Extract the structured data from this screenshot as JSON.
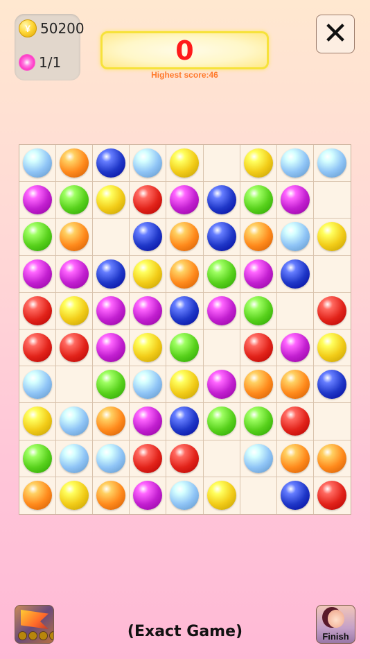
{
  "stats": {
    "coins": "50200",
    "lives": "1/1"
  },
  "score": {
    "current": "0",
    "highest_label": "Highest score:46"
  },
  "buttons": {
    "close_icon": "close-icon",
    "finish_label": "Finish"
  },
  "footer": {
    "mode_label": "(Exact Game)"
  },
  "colors": {
    "red": "#e2231a",
    "orange": "#ff8a1c",
    "yellow": "#f2cc18",
    "green": "#58d11c",
    "blue": "#1f37c8",
    "purple": "#c21fd0",
    "lightblue": "#8fc4f6"
  },
  "board": {
    "rows": 10,
    "cols": 9,
    "cells": [
      [
        "lightblue",
        "orange",
        "blue",
        "lightblue",
        "yellow",
        "",
        "yellow",
        "lightblue",
        "lightblue"
      ],
      [
        "purple",
        "green",
        "yellow",
        "red",
        "purple",
        "blue",
        "green",
        "purple",
        ""
      ],
      [
        "green",
        "orange",
        "",
        "blue",
        "orange",
        "blue",
        "orange",
        "lightblue",
        "yellow"
      ],
      [
        "purple",
        "purple",
        "blue",
        "yellow",
        "orange",
        "green",
        "purple",
        "blue",
        ""
      ],
      [
        "red",
        "yellow",
        "purple",
        "purple",
        "blue",
        "purple",
        "green",
        "",
        "red"
      ],
      [
        "red",
        "red",
        "purple",
        "yellow",
        "green",
        "",
        "red",
        "purple",
        "yellow"
      ],
      [
        "lightblue",
        "",
        "green",
        "lightblue",
        "yellow",
        "purple",
        "orange",
        "orange",
        "blue"
      ],
      [
        "yellow",
        "lightblue",
        "orange",
        "purple",
        "blue",
        "green",
        "green",
        "red",
        ""
      ],
      [
        "green",
        "lightblue",
        "lightblue",
        "red",
        "red",
        "",
        "lightblue",
        "orange",
        "orange"
      ],
      [
        "orange",
        "yellow",
        "orange",
        "purple",
        "lightblue",
        "yellow",
        "",
        "blue",
        "red"
      ]
    ]
  }
}
